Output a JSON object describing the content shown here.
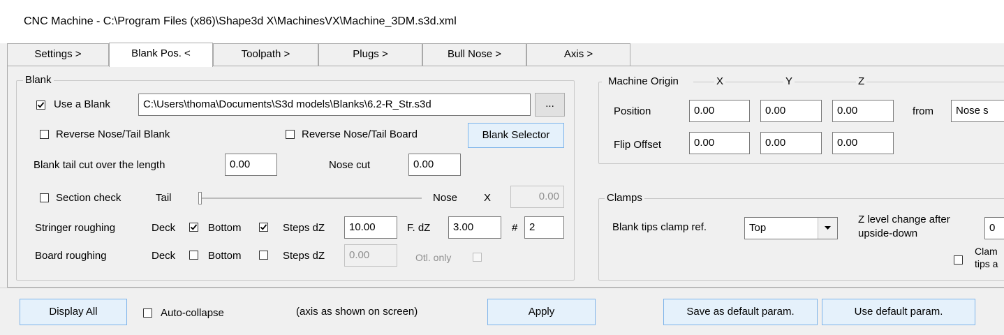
{
  "window": {
    "title": "CNC Machine - C:\\Program Files (x86)\\Shape3d X\\MachinesVX\\Machine_3DM.s3d.xml"
  },
  "tabs": [
    {
      "label": "Settings >"
    },
    {
      "label": "Blank Pos. <"
    },
    {
      "label": "Toolpath >"
    },
    {
      "label": "Plugs >"
    },
    {
      "label": "Bull Nose >"
    },
    {
      "label": "Axis >"
    }
  ],
  "blank": {
    "group_title": "Blank",
    "use_blank_label": "Use a Blank",
    "use_blank_checked": true,
    "blank_path": "C:\\Users\\thoma\\Documents\\S3d models\\Blanks\\6.2-R_Str.s3d",
    "browse_label": "...",
    "reverse_blank_label": "Reverse Nose/Tail Blank",
    "reverse_board_label": "Reverse Nose/Tail Board",
    "blank_selector_label": "Blank Selector",
    "tail_cut_label": "Blank tail cut over the length",
    "tail_cut_value": "0.00",
    "nose_cut_label": "Nose cut",
    "nose_cut_value": "0.00",
    "section_check_label": "Section check",
    "tail_label": "Tail",
    "nose_label": "Nose",
    "x_label": "X",
    "x_value": "0.00",
    "stringer_label": "Stringer roughing",
    "deck_label": "Deck",
    "bottom_label": "Bottom",
    "steps_label": "Steps dZ",
    "stringer_steps_value": "10.00",
    "fdz_label": "F. dZ",
    "fdz_value": "3.00",
    "hash_label": "#",
    "hash_value": "2",
    "board_label": "Board roughing",
    "board_steps_value": "0.00",
    "otl_label": "Otl. only"
  },
  "origin": {
    "group_title": "Machine Origin",
    "col_x": "X",
    "col_y": "Y",
    "col_z": "Z",
    "position_label": "Position",
    "position": [
      "0.00",
      "0.00",
      "0.00"
    ],
    "from_label": "from",
    "from_value": "Nose s",
    "flip_label": "Flip Offset",
    "flip": [
      "0.00",
      "0.00",
      "0.00"
    ]
  },
  "clamps": {
    "group_title": "Clamps",
    "tips_ref_label": "Blank tips clamp ref.",
    "tips_ref_value": "Top",
    "zlevel_label_1": "Z level change after",
    "zlevel_label_2": "upside-down",
    "zlevel_value": "0",
    "clamp_label_1": "Clam",
    "clamp_label_2": "tips a"
  },
  "footer": {
    "display_all": "Display All",
    "auto_collapse": "Auto-collapse",
    "axis_note": "(axis as shown on screen)",
    "apply": "Apply",
    "save_default": "Save as default param.",
    "use_default": "Use default param."
  }
}
